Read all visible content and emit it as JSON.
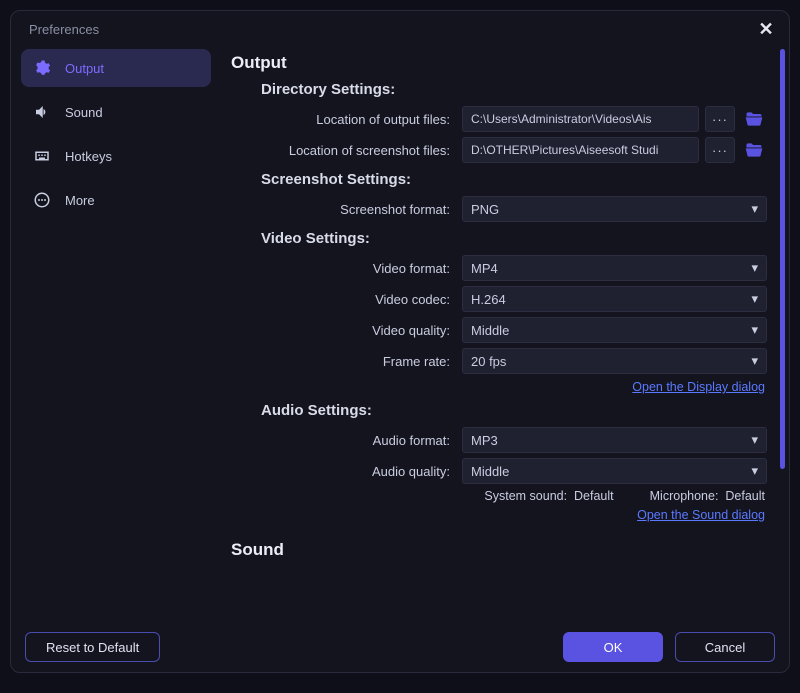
{
  "window": {
    "title": "Preferences"
  },
  "sidebar": {
    "items": [
      {
        "label": "Output"
      },
      {
        "label": "Sound"
      },
      {
        "label": "Hotkeys"
      },
      {
        "label": "More"
      }
    ]
  },
  "sections": {
    "output_title": "Output",
    "sound_title": "Sound",
    "directory": {
      "title": "Directory Settings:",
      "output_label": "Location of output files:",
      "output_value": "C:\\Users\\Administrator\\Videos\\Ais",
      "screenshot_label": "Location of screenshot files:",
      "screenshot_value": "D:\\OTHER\\Pictures\\Aiseesoft Studi",
      "ellipsis": "···"
    },
    "screenshot": {
      "title": "Screenshot Settings:",
      "format_label": "Screenshot format:",
      "format_value": "PNG"
    },
    "video": {
      "title": "Video Settings:",
      "format_label": "Video format:",
      "format_value": "MP4",
      "codec_label": "Video codec:",
      "codec_value": "H.264",
      "quality_label": "Video quality:",
      "quality_value": "Middle",
      "framerate_label": "Frame rate:",
      "framerate_value": "20 fps",
      "link": "Open the Display dialog"
    },
    "audio": {
      "title": "Audio Settings:",
      "format_label": "Audio format:",
      "format_value": "MP3",
      "quality_label": "Audio quality:",
      "quality_value": "Middle",
      "system_sound_label": "System sound:",
      "system_sound_value": "Default",
      "microphone_label": "Microphone:",
      "microphone_value": "Default",
      "link": "Open the Sound dialog"
    }
  },
  "footer": {
    "reset": "Reset to Default",
    "ok": "OK",
    "cancel": "Cancel"
  }
}
